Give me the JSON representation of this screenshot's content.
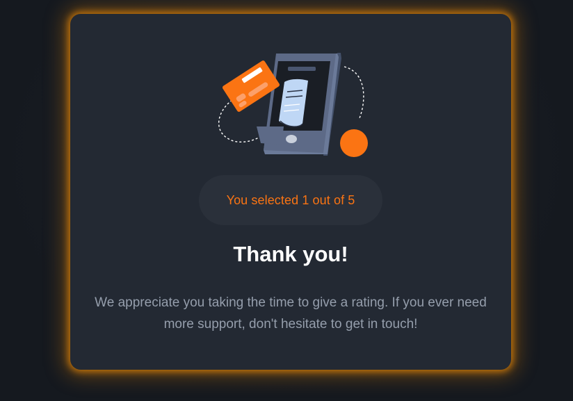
{
  "card": {
    "illustration_name": "payment-phone-illustration",
    "selection_text": "You selected 1 out of 5",
    "title": "Thank you!",
    "message": "We appreciate you taking the time to give a rating. If you ever need more support, don't hesitate to get in touch!"
  },
  "colors": {
    "accent": "#fb7413",
    "card_background": "#232933",
    "page_background": "#15191f",
    "glow": "#e88705",
    "text_muted": "#959eac",
    "title": "#ffffff"
  }
}
